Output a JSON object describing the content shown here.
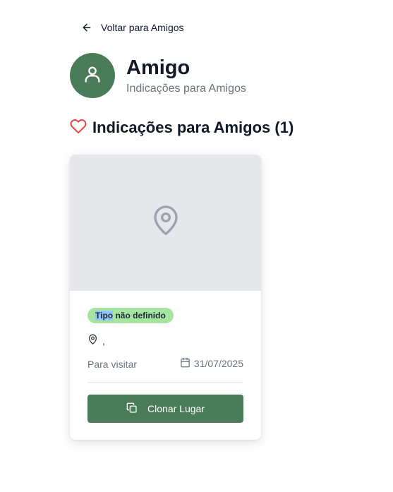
{
  "nav": {
    "back_label": "Voltar para Amigos",
    "back_icon": "arrow-left-icon"
  },
  "profile": {
    "name": "Amigo",
    "subtitle": "Indicações para Amigos",
    "avatar_icon": "user-icon",
    "avatar_color": "#4a7c59"
  },
  "section": {
    "title": "Indicações para Amigos (1)",
    "icon": "heart-icon",
    "icon_color": "#ef4444"
  },
  "places": [
    {
      "image_icon": "map-pin-icon",
      "type_badge_highlight": "Tipo",
      "type_badge_rest": " não definido",
      "location": ",",
      "status": "Para visitar",
      "date": "31/07/2025",
      "clone_label": "Clonar Lugar"
    }
  ],
  "colors": {
    "primary": "#4a7c59",
    "badge_bg": "#a7e3a1",
    "image_placeholder": "#e5e7eb"
  }
}
